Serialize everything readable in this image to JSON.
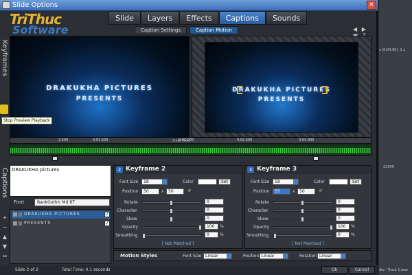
{
  "window": {
    "title": "Slide Options",
    "close_label": "✕"
  },
  "logo": {
    "line1": "TriThuc",
    "line2": "Software"
  },
  "tabs": [
    {
      "label": "Slide"
    },
    {
      "label": "Layers"
    },
    {
      "label": "Effects"
    },
    {
      "label": "Captions"
    },
    {
      "label": "Sounds"
    }
  ],
  "active_tab": "Captions",
  "subtabs": [
    {
      "label": "Caption Settings"
    },
    {
      "label": "Caption Motion"
    }
  ],
  "side_tabs": {
    "keyframes": "Keyframes",
    "captions": "Captions"
  },
  "preview": {
    "line1": "DRAKUKHA PICTURES",
    "line2": "PRESENTS"
  },
  "tooltip": "Stop Preview Playback",
  "timeline": {
    "ticks": [
      "2.500",
      "0:01.500",
      "0:02.000",
      "0:02.500",
      "0:03.000"
    ],
    "label": "Slide Time"
  },
  "caption_text": "DRAKUKHA pictures",
  "font": {
    "label": "Font",
    "value": "BankGothic Md BT"
  },
  "layers": [
    {
      "name": "DRAKUKHA PICTURES",
      "checked": true
    },
    {
      "name": "PRESENTS",
      "checked": true
    }
  ],
  "keyframe2": {
    "number": "2",
    "title": "Keyframe 2",
    "font_size_label": "Font Size",
    "font_size": "18",
    "color_label": "Color",
    "set_label": "Set",
    "position_label": "Position",
    "pos_x": "50",
    "pos_sep": "x",
    "pos_y": "50",
    "rotate_label": "Rotate",
    "rotate": "0",
    "character_label": "Character",
    "character": "0",
    "skew_label": "Skew",
    "skew": "0",
    "opacity_label": "Opacity",
    "opacity": "100",
    "opacity_unit": "%",
    "smoothing_label": "Smoothing",
    "smoothing": "0",
    "smoothing_unit": "%",
    "matched": "[ Not Matched ]"
  },
  "keyframe3": {
    "number": "3",
    "title": "Keyframe 3",
    "font_size_label": "Font Size",
    "font_size": "18",
    "color_label": "Color",
    "set_label": "Set",
    "position_label": "Position",
    "pos_x": "55",
    "pos_sep": "x",
    "pos_y": "50",
    "rotate_label": "Rotate",
    "rotate": "0",
    "character_label": "Character",
    "character": "0",
    "skew_label": "Skew",
    "skew": "0",
    "opacity_label": "Opacity",
    "opacity": "100",
    "opacity_unit": "%",
    "smoothing_label": "Smoothing",
    "smoothing": "0",
    "smoothing_unit": "%",
    "matched": "[ Not Matched ]"
  },
  "motion_styles": {
    "label": "Motion Styles",
    "font_size_label": "Font Size",
    "font_size_value": "Linear",
    "position_label": "Position",
    "position_value": "Linear",
    "rotation_label": "Rotation",
    "rotation_value": "Linear"
  },
  "footer": {
    "slide": "Slide 2 of 2",
    "total_time": "Total Time: 4.1 seconds",
    "ok": "Ok",
    "cancel": "Cancel"
  },
  "background_app": {
    "time": "s (0:04.90), 1 s",
    "ruler": "22000",
    "track": "dio - Track 1.wav"
  }
}
